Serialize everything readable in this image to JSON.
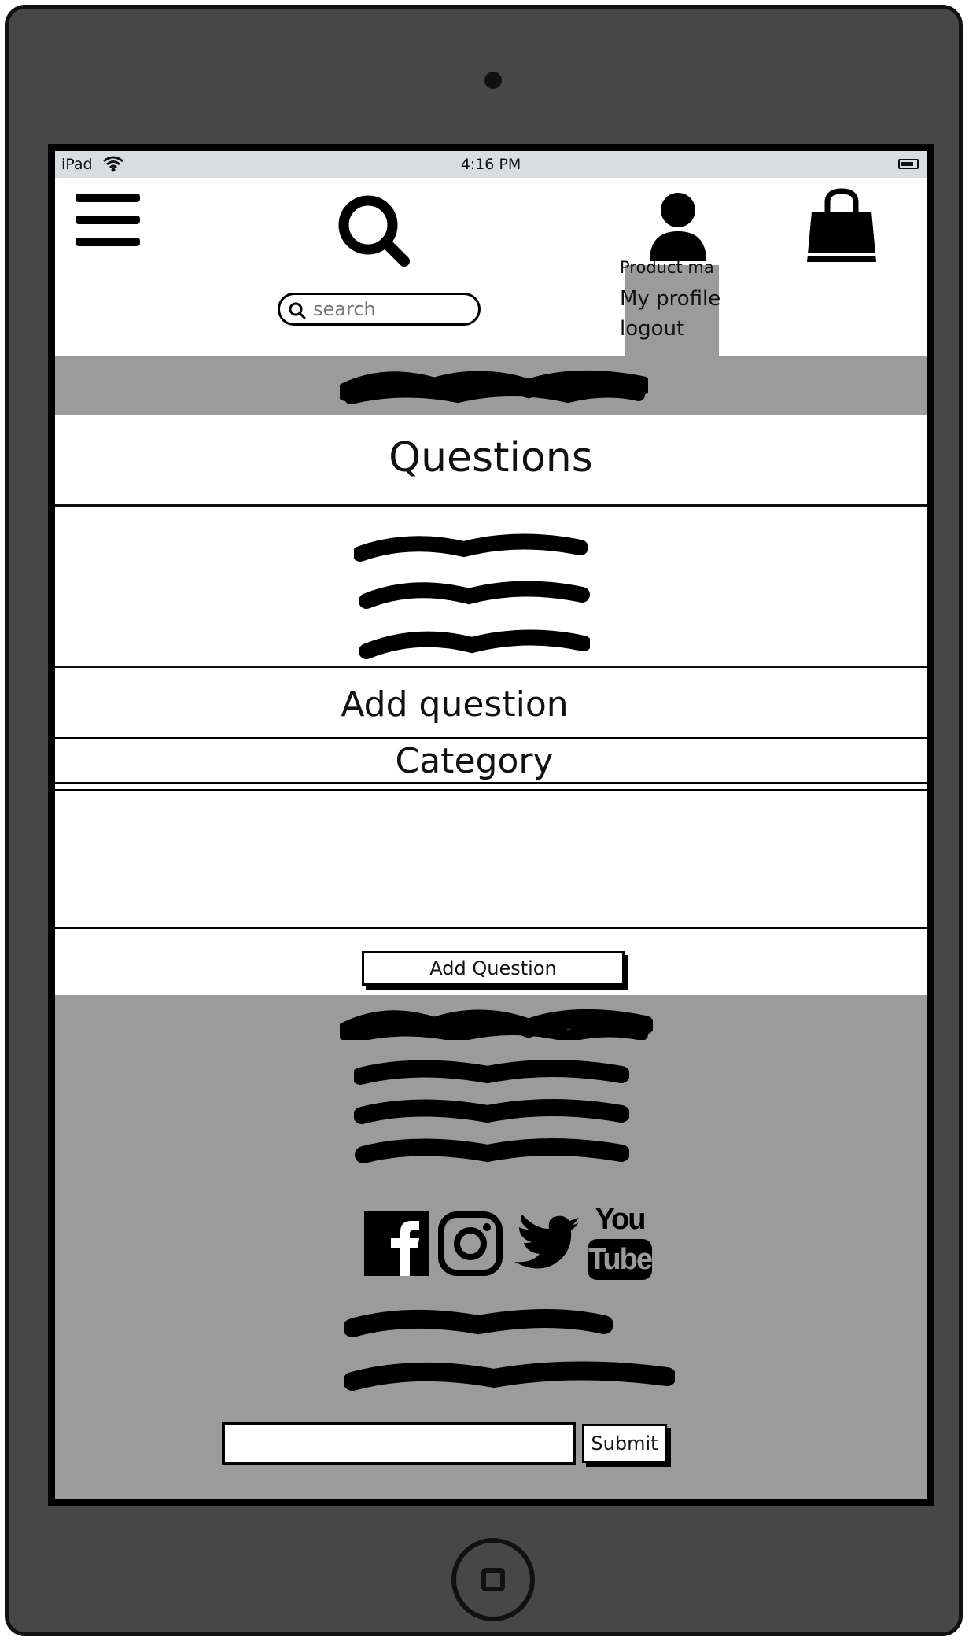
{
  "device": {
    "name": "iPad",
    "time": "4:16 PM"
  },
  "header": {
    "search_placeholder": "search",
    "dropdown": {
      "title": "Product ma",
      "items": [
        "My profile",
        "logout"
      ]
    }
  },
  "main": {
    "title": "Questions",
    "add_title": "Add question",
    "category_label": "Category",
    "textarea_value": "",
    "submit_label": "Add Question"
  },
  "footer": {
    "social_icons": [
      "facebook-icon",
      "instagram-icon",
      "twitter-icon",
      "youtube-icon"
    ],
    "youtube_top": "You",
    "youtube_bottom": "Tube",
    "newsletter_value": "",
    "submit_label": "Submit"
  },
  "colors": {
    "device": "#474747",
    "band": "#9b9b9b",
    "status_bar": "#d8dde0"
  }
}
